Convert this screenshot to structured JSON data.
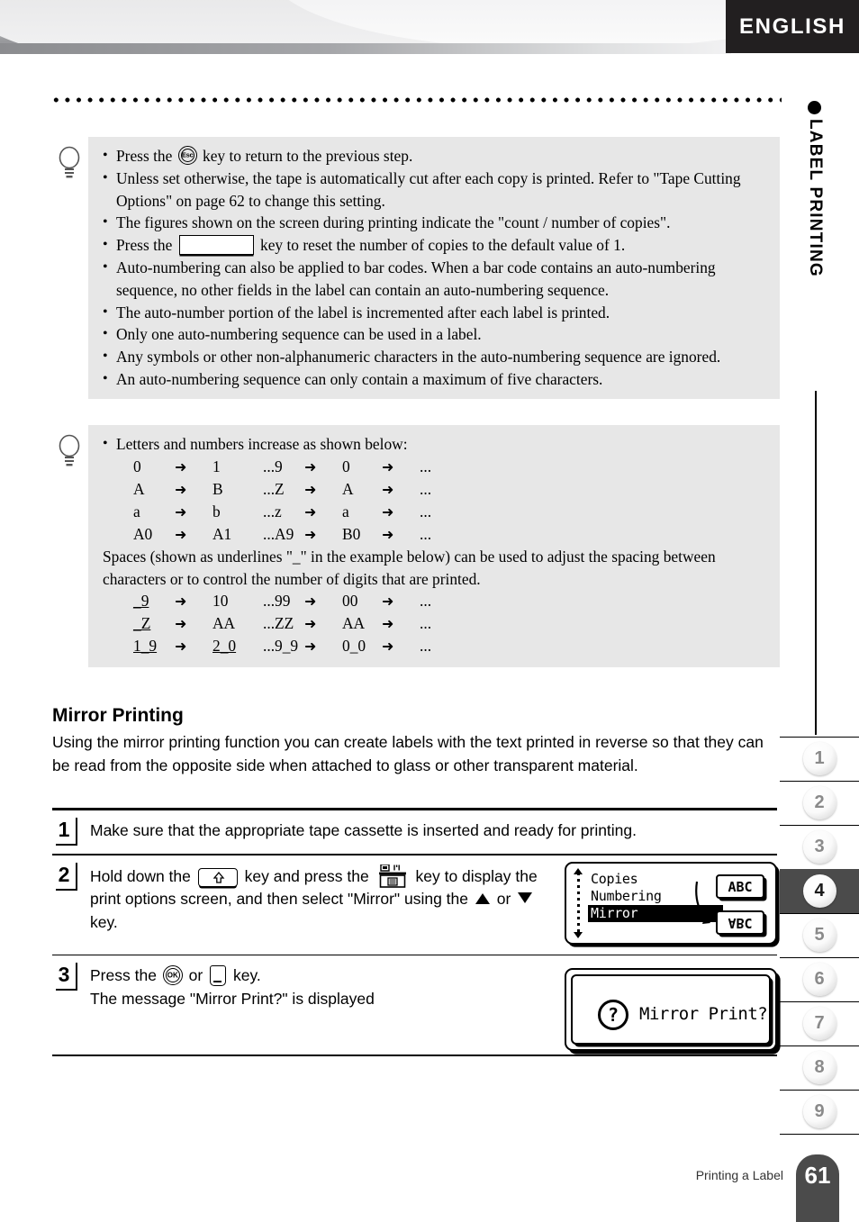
{
  "header": {
    "language_tab": "ENGLISH",
    "rail_label": "LABEL PRINTING"
  },
  "tip_block_1": {
    "icon": "lightbulb-icon",
    "bullets": [
      {
        "pre": "Press the ",
        "key": "esc-key",
        "post": " key to return to the previous step."
      },
      {
        "pre": "Unless set otherwise, the tape is automatically cut after each copy is printed. Refer to \"Tape Cutting Options\" on page 62 to change this setting."
      },
      {
        "pre": "The figures shown on the screen during printing indicate the \"count / number of copies\"."
      },
      {
        "pre": "Press the ",
        "key": "blank-key",
        "post": " key to reset the number of copies to the default value of 1."
      },
      {
        "pre": "Auto-numbering can also be applied to bar codes. When a bar code contains an auto-numbering sequence, no other fields in the label can contain an auto-numbering sequence."
      },
      {
        "pre": "The auto-number portion of the label is incremented after each label is printed."
      },
      {
        "pre": "Only one auto-numbering sequence can be used in a label."
      },
      {
        "pre": "Any symbols or other non-alphanumeric characters in the auto-numbering sequence are ignored."
      },
      {
        "pre": "An auto-numbering sequence can only contain a maximum of five characters."
      }
    ]
  },
  "tip_block_2": {
    "icon": "lightbulb-icon",
    "intro": "Letters and numbers increase as shown below:",
    "sequences_1": [
      {
        "c1": "0",
        "a1": "➜",
        "c2": "1",
        "c3": "...9",
        "a2": "➜",
        "c4": "0",
        "a3": "➜",
        "c5": "..."
      },
      {
        "c1": "A",
        "a1": "➜",
        "c2": "B",
        "c3": "...Z",
        "a2": "➜",
        "c4": "A",
        "a3": "➜",
        "c5": "..."
      },
      {
        "c1": "a",
        "a1": "➜",
        "c2": "b",
        "c3": "...z",
        "a2": "➜",
        "c4": "a",
        "a3": "➜",
        "c5": "..."
      },
      {
        "c1": "A0",
        "a1": "➜",
        "c2": "A1",
        "c3": "...A9",
        "a2": "➜",
        "c4": "B0",
        "a3": "➜",
        "c5": "..."
      }
    ],
    "note": "Spaces (shown as underlines \"_\" in the example below) can be used to adjust the spacing between characters or to control the number of digits that are printed.",
    "sequences_2": [
      {
        "c1": "_9",
        "a1": "➜",
        "c2": "10",
        "c3": "...99",
        "a2": "➜",
        "c4": "00",
        "a3": "➜",
        "c5": "..."
      },
      {
        "c1": "_Z",
        "a1": "➜",
        "c2": "AA",
        "c3": "...ZZ",
        "a2": "➜",
        "c4": "AA",
        "a3": "➜",
        "c5": "..."
      },
      {
        "c1": "1_9",
        "a1": "➜",
        "c2": "2_0",
        "c3": "...9_9",
        "a2": "➜",
        "c4": "0_0",
        "a3": "➜",
        "c5": "..."
      }
    ]
  },
  "mirror_section": {
    "title": "Mirror Printing",
    "body": "Using the mirror printing function you can create labels with the text printed in reverse so that they can be read from the opposite side when attached to glass or other transparent material.",
    "steps": [
      {
        "number": "1",
        "text": "Make sure that the appropriate tape cassette is inserted and ready for printing."
      },
      {
        "number": "2",
        "t1": "Hold down the ",
        "key1": "shift-key",
        "t2": " key and press the ",
        "key2": "print-options-key",
        "t3": " key to display the print options screen, and then select \"Mirror\" using the ",
        "key3": "up-arrow-key",
        "t4": " or ",
        "key4": "down-arrow-key",
        "t5": " key."
      },
      {
        "number": "3",
        "t1": "Press the ",
        "key1": "ok-key",
        "t2": " or ",
        "key2": "enter-key",
        "t3": " key.",
        "line2": "The message \"Mirror Print?\" is displayed"
      }
    ]
  },
  "lcd_options": {
    "items": [
      "Copies",
      "Numbering",
      "Mirror"
    ],
    "selected": "Mirror",
    "chip_normal": "ABC",
    "chip_mirror": "ABC"
  },
  "lcd_confirm": {
    "icon": "question-mark-icon",
    "message": "Mirror Print?"
  },
  "side_tabs": {
    "items": [
      "1",
      "2",
      "3",
      "4",
      "5",
      "6",
      "7",
      "8",
      "9"
    ],
    "active": "4"
  },
  "footer": {
    "caption": "Printing a Label",
    "page_number": "61"
  },
  "colors": {
    "tip_bg": "#e7e7e7",
    "tab_active_bg": "#4b4b4b",
    "lang_tab_bg": "#221f20",
    "page_badge_bg": "#4b4b4b"
  }
}
